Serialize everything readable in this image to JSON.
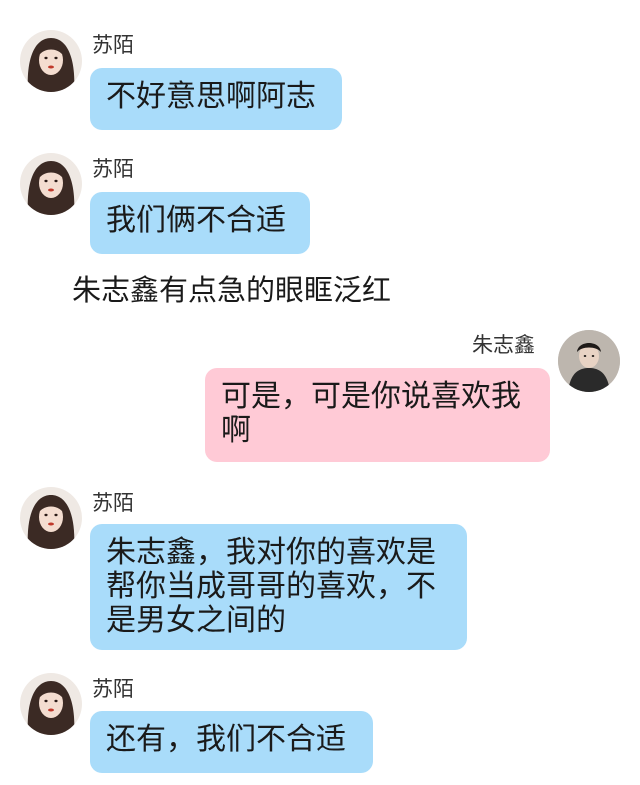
{
  "messages": [
    {
      "side": "left",
      "sender": "苏陌",
      "text": "不好意思啊阿志"
    },
    {
      "side": "left",
      "sender": "苏陌",
      "text": "我们俩不合适"
    },
    {
      "narration": "朱志鑫有点急的眼眶泛红"
    },
    {
      "side": "right",
      "sender": "朱志鑫",
      "text": "可是，可是你说喜欢我\n啊"
    },
    {
      "side": "left",
      "sender": "苏陌",
      "text": "朱志鑫，我对你的喜欢是\n帮你当成哥哥的喜欢，不\n是男女之间的"
    },
    {
      "side": "left",
      "sender": "苏陌",
      "text": "还有，我们不合适"
    }
  ],
  "colors": {
    "left_bubble": "#a9dcfa",
    "right_bubble": "#ffcad6"
  },
  "icons": {
    "left_avatar": "girl-avatar-icon",
    "right_avatar": "boy-avatar-icon"
  }
}
